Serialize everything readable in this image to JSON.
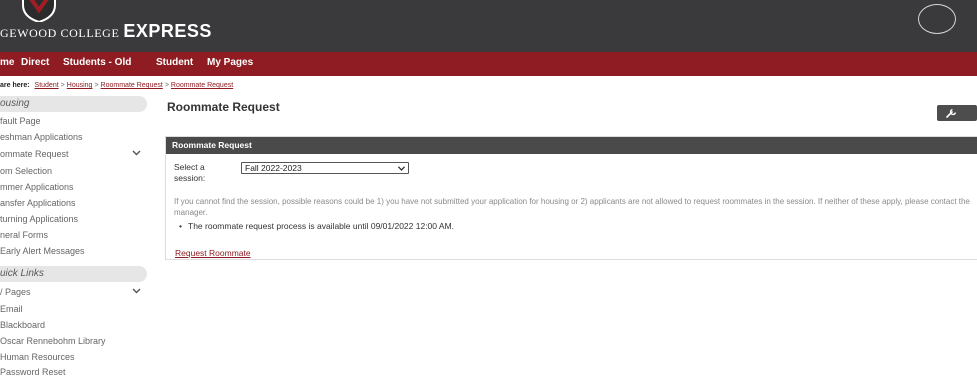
{
  "header": {
    "college": "GEWOOD COLLEGE",
    "product": "EXPRESS"
  },
  "nav": {
    "items": [
      "me",
      "Direct",
      "Students - Old",
      "Student",
      "My Pages"
    ]
  },
  "breadcrumb": {
    "prefix": "are here:",
    "items": [
      "Student",
      "Housing",
      "Roommate Request",
      "Roommate Request"
    ],
    "separator": ">"
  },
  "sidebar": {
    "section1": {
      "title": "ousing",
      "items": [
        "fault Page",
        "eshman Applications",
        "ommate Request",
        "om Selection",
        "mmer Applications",
        "ansfer Applications",
        "turning Applications",
        "neral Forms",
        "Early Alert Messages"
      ]
    },
    "section2": {
      "title": "uick Links",
      "items": [
        "/ Pages",
        "Email",
        "Blackboard",
        "Oscar Rennebohm Library",
        "Human Resources",
        "Password Reset"
      ]
    }
  },
  "main": {
    "title": "Roommate Request",
    "panel": {
      "header": "Roommate Request",
      "session_label": "Select a session:",
      "session_value": "Fall 2022-2023",
      "note": "If you cannot find the session, possible reasons could be 1) you have not submitted your application for housing or 2) applicants are not allowed to request roommates in the session. If neither of these apply, please contact the manager.",
      "bullet": "The roommate request process is available until 09/01/2022 12:00 AM.",
      "link": "Request Roommate"
    }
  },
  "colors": {
    "header_bg": "#3a3a3d",
    "nav_bg": "#8f1c22",
    "link": "#8f1c22",
    "panel_header_bg": "#4a4a4a"
  },
  "icons": [
    "crest-icon",
    "user-circle-icon",
    "chevron-down-icon",
    "wrench-icon"
  ]
}
